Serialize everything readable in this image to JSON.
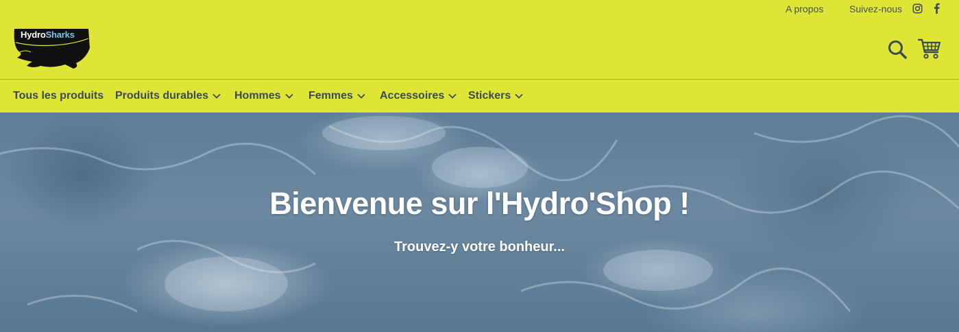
{
  "topbar": {
    "about_label": "A propos",
    "follow_label": "Suivez-nous",
    "social_icons": [
      "instagram-icon",
      "facebook-icon"
    ]
  },
  "logo": {
    "text_part1": "Hydro",
    "text_part2": "Sharks"
  },
  "header_icons": [
    "search-icon",
    "cart-icon"
  ],
  "nav": {
    "items": [
      {
        "label": "Tous les produits",
        "dropdown": false
      },
      {
        "label": "Produits durables",
        "dropdown": true
      },
      {
        "label": "Hommes",
        "dropdown": true
      },
      {
        "label": "Femmes",
        "dropdown": true
      },
      {
        "label": "Accessoires",
        "dropdown": true
      },
      {
        "label": "Stickers",
        "dropdown": true
      }
    ]
  },
  "hero": {
    "title": "Bienvenue sur l'Hydro'Shop !",
    "subtitle": "Trouvez-y votre bonheur..."
  },
  "colors": {
    "header_bg": "#dfe535",
    "nav_text": "#3a4a57",
    "logo_accent": "#7dc3e6",
    "hero_text": "#ffffff"
  }
}
